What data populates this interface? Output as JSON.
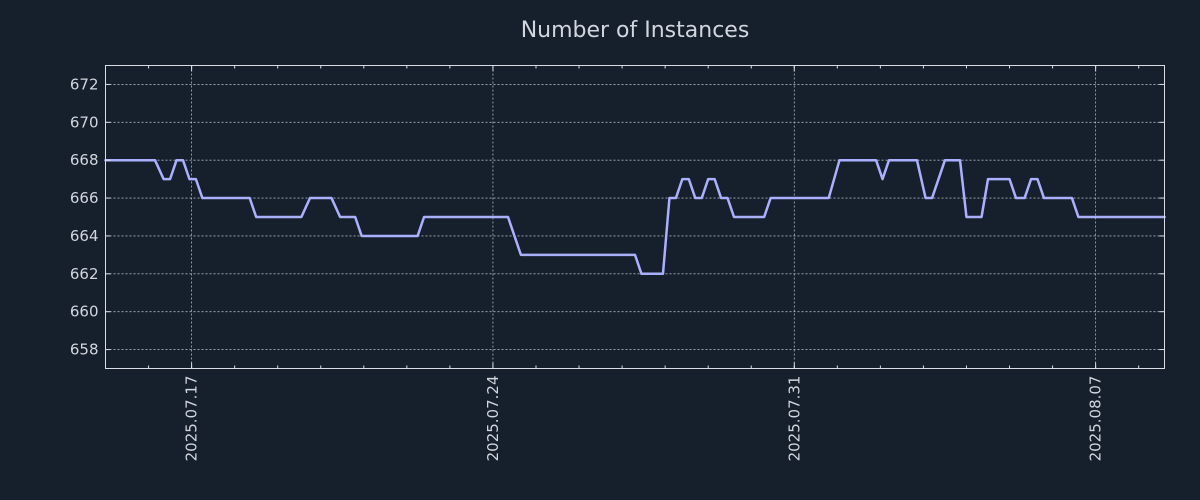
{
  "chart_data": {
    "type": "line",
    "title": "Number of Instances",
    "xlabel": "",
    "ylabel": "",
    "x_start": "2025-07-15",
    "x_range_days": [
      0,
      24.6
    ],
    "ylim": [
      657,
      673
    ],
    "yticks": [
      658,
      660,
      662,
      664,
      666,
      668,
      670,
      672
    ],
    "xticks": [
      {
        "label": "2025.07.17",
        "day": 2.0
      },
      {
        "label": "2025.07.24",
        "day": 9.0
      },
      {
        "label": "2025.07.31",
        "day": 16.0
      },
      {
        "label": "2025.08.07",
        "day": 23.0
      }
    ],
    "grid": true,
    "line_color": "#aab0ff",
    "background": "#161f2c",
    "series": [
      {
        "name": "",
        "points": [
          [
            0.0,
            668
          ],
          [
            1.15,
            668
          ],
          [
            1.35,
            667
          ],
          [
            1.5,
            667
          ],
          [
            1.65,
            668
          ],
          [
            1.8,
            668
          ],
          [
            1.95,
            667
          ],
          [
            2.1,
            667
          ],
          [
            2.25,
            666
          ],
          [
            3.35,
            666
          ],
          [
            3.5,
            665
          ],
          [
            4.55,
            665
          ],
          [
            4.75,
            666
          ],
          [
            5.25,
            666
          ],
          [
            5.45,
            665
          ],
          [
            5.8,
            665
          ],
          [
            5.95,
            664
          ],
          [
            7.25,
            664
          ],
          [
            7.4,
            665
          ],
          [
            9.35,
            665
          ],
          [
            9.65,
            663
          ],
          [
            12.3,
            663
          ],
          [
            12.45,
            662
          ],
          [
            12.95,
            662
          ],
          [
            13.1,
            666
          ],
          [
            13.25,
            666
          ],
          [
            13.4,
            667
          ],
          [
            13.55,
            667
          ],
          [
            13.7,
            666
          ],
          [
            13.85,
            666
          ],
          [
            14.0,
            667
          ],
          [
            14.15,
            667
          ],
          [
            14.3,
            666
          ],
          [
            14.45,
            666
          ],
          [
            14.6,
            665
          ],
          [
            15.3,
            665
          ],
          [
            15.45,
            666
          ],
          [
            16.8,
            666
          ],
          [
            17.05,
            668
          ],
          [
            17.9,
            668
          ],
          [
            18.05,
            667
          ],
          [
            18.2,
            668
          ],
          [
            18.85,
            668
          ],
          [
            19.05,
            666
          ],
          [
            19.2,
            666
          ],
          [
            19.5,
            668
          ],
          [
            19.85,
            668
          ],
          [
            20.0,
            665
          ],
          [
            20.35,
            665
          ],
          [
            20.5,
            667
          ],
          [
            21.0,
            667
          ],
          [
            21.15,
            666
          ],
          [
            21.35,
            666
          ],
          [
            21.5,
            667
          ],
          [
            21.65,
            667
          ],
          [
            21.8,
            666
          ],
          [
            22.45,
            666
          ],
          [
            22.6,
            665
          ],
          [
            24.6,
            665
          ]
        ]
      }
    ]
  }
}
